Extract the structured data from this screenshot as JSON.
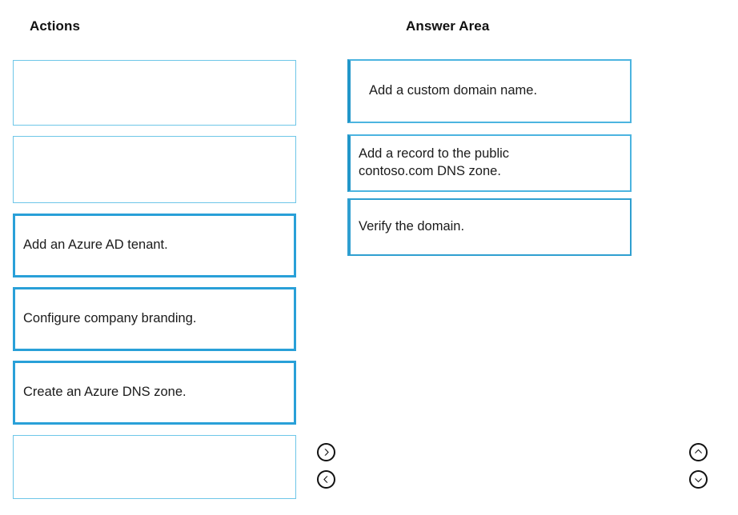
{
  "columns": {
    "actions": {
      "header": "Actions",
      "slots": [
        {
          "label": "",
          "filled": false
        },
        {
          "label": "",
          "filled": false
        },
        {
          "label": "Add an Azure AD tenant.",
          "filled": true
        },
        {
          "label": "Configure company branding.",
          "filled": true
        },
        {
          "label": "Create an Azure DNS zone.",
          "filled": true
        },
        {
          "label": "",
          "filled": false
        }
      ]
    },
    "answer_area": {
      "header": "Answer Area",
      "items": [
        {
          "label": "Add a custom domain name."
        },
        {
          "label": "Add a record to the public\ncontoso.com DNS zone."
        },
        {
          "label": "Verify the domain."
        }
      ]
    }
  },
  "controls": {
    "move_right": {
      "icon": "chevron-right-icon"
    },
    "move_left": {
      "icon": "chevron-left-icon"
    },
    "move_up": {
      "icon": "chevron-up-icon"
    },
    "move_down": {
      "icon": "chevron-down-icon"
    }
  },
  "colors": {
    "tile_border": "#29a0d8",
    "slot_border": "#6ec6e8",
    "answer_border": "#4cb4e0",
    "answer_border_accent": "#2196c9",
    "text": "#1b1b1b",
    "background": "#ffffff"
  }
}
